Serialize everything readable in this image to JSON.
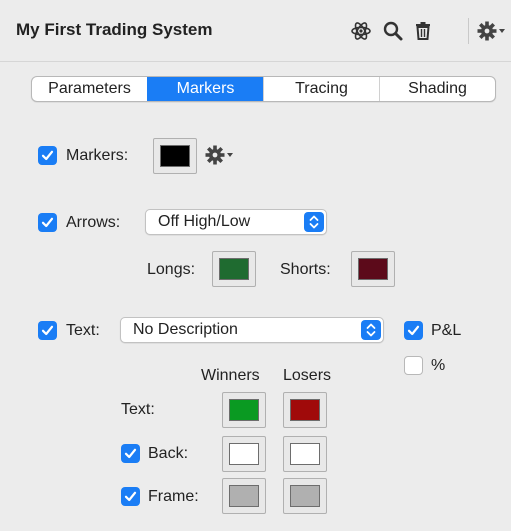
{
  "header": {
    "title": "My First Trading System",
    "icons": [
      "atom-icon",
      "search-icon",
      "trash-icon",
      "gear-menu-icon"
    ]
  },
  "tabs": [
    {
      "label": "Parameters",
      "active": false
    },
    {
      "label": "Markers",
      "active": true
    },
    {
      "label": "Tracing",
      "active": false
    },
    {
      "label": "Shading",
      "active": false
    }
  ],
  "markers": {
    "label": "Markers:",
    "checked": true,
    "color": "#000000"
  },
  "arrows": {
    "label": "Arrows:",
    "checked": true,
    "selected": "Off High/Low",
    "longs_label": "Longs:",
    "longs_color": "#1f6b30",
    "shorts_label": "Shorts:",
    "shorts_color": "#5c0a1a"
  },
  "text": {
    "label": "Text:",
    "checked": true,
    "selected": "No Description",
    "pl_label": "P&L",
    "pl_checked": true,
    "pct_label": "%",
    "pct_checked": false,
    "col_winners": "Winners",
    "col_losers": "Losers",
    "rows": [
      {
        "label": "Text:",
        "has_checkbox": false,
        "winners": "#0a9a22",
        "losers": "#a00a0a"
      },
      {
        "label": "Back:",
        "has_checkbox": true,
        "checked": true,
        "winners": "#ffffff",
        "losers": "#ffffff"
      },
      {
        "label": "Frame:",
        "has_checkbox": true,
        "checked": true,
        "winners": "#b0b0b0",
        "losers": "#b0b0b0"
      }
    ]
  },
  "colors": {
    "accent": "#1a7df5"
  }
}
